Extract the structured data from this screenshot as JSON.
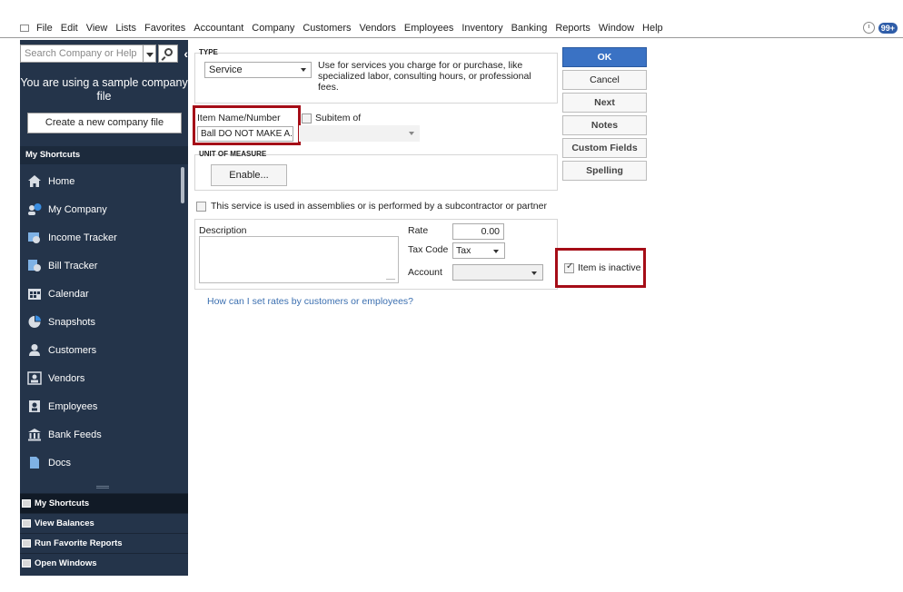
{
  "menu": {
    "items": [
      "File",
      "Edit",
      "View",
      "Lists",
      "Favorites",
      "Accountant",
      "Company",
      "Customers",
      "Vendors",
      "Employees",
      "Inventory",
      "Banking",
      "Reports",
      "Window",
      "Help"
    ],
    "badge": "99+"
  },
  "sidebar": {
    "search_placeholder": "Search Company or Help",
    "sample_text": "You are using a sample company file",
    "create_button": "Create a new company file",
    "shortcuts_header": "My Shortcuts",
    "items": [
      {
        "label": "Home",
        "icon": "home-icon"
      },
      {
        "label": "My Company",
        "icon": "company-icon"
      },
      {
        "label": "Income Tracker",
        "icon": "income-tracker-icon"
      },
      {
        "label": "Bill Tracker",
        "icon": "bill-tracker-icon"
      },
      {
        "label": "Calendar",
        "icon": "calendar-icon"
      },
      {
        "label": "Snapshots",
        "icon": "pie-chart-icon"
      },
      {
        "label": "Customers",
        "icon": "person-icon"
      },
      {
        "label": "Vendors",
        "icon": "vendor-icon"
      },
      {
        "label": "Employees",
        "icon": "employee-icon"
      },
      {
        "label": "Bank Feeds",
        "icon": "bank-icon"
      },
      {
        "label": "Docs",
        "icon": "document-icon"
      }
    ],
    "bottom": [
      "My Shortcuts",
      "View Balances",
      "Run Favorite Reports",
      "Open Windows"
    ]
  },
  "form": {
    "type_label": "TYPE",
    "type_value": "Service",
    "type_desc": "Use for services you charge for or purchase, like specialized labor, consulting hours, or professional fees.",
    "item_name_label": "Item Name/Number",
    "item_name_value": "Ball DO NOT MAKE A...",
    "subitem_label": "Subitem of",
    "uom_label": "UNIT OF MEASURE",
    "enable_button": "Enable...",
    "assembly_label": "This service is used in assemblies or is performed by a subcontractor or partner",
    "description_label": "Description",
    "rate_label": "Rate",
    "rate_value": "0.00",
    "tax_code_label": "Tax Code",
    "tax_code_value": "Tax",
    "account_label": "Account",
    "rates_link": "How can I set rates by customers or employees?"
  },
  "buttons": {
    "ok": "OK",
    "cancel": "Cancel",
    "next": "Next",
    "notes": "Notes",
    "custom_fields": "Custom Fields",
    "spelling": "Spelling"
  },
  "inactive": {
    "label": "Item is inactive",
    "checked": true
  },
  "colors": {
    "sidebar_bg": "#24344a",
    "highlight": "#a50d17",
    "ok_button": "#3a72c4",
    "link": "#3b6fb0"
  }
}
